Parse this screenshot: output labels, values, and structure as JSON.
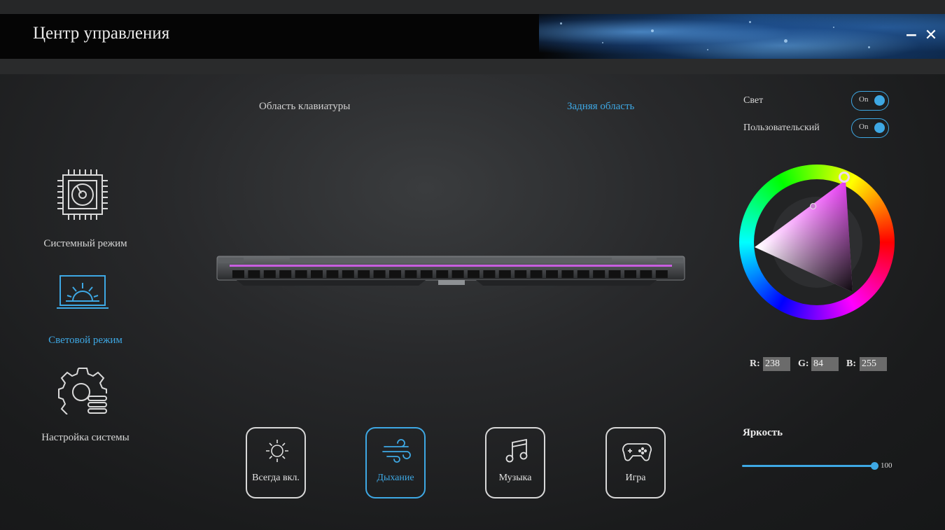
{
  "window": {
    "title": "Центр управления",
    "minimize_icon": "minus-icon",
    "close_icon": "close-x-icon",
    "minimize_glyph": "−",
    "close_glyph": "✕"
  },
  "sidebar": {
    "items": [
      {
        "label": "Системный режим",
        "icon": "cpu-chip-icon",
        "active": false
      },
      {
        "label": "Световой режим",
        "icon": "laptop-sunrise-icon",
        "active": true
      },
      {
        "label": "Настройка системы",
        "icon": "gear-settings-icon",
        "active": false
      }
    ]
  },
  "areas": {
    "keyboard": "Область клавиатуры",
    "rear": "Задняя область",
    "selected": "rear"
  },
  "lighting": {
    "light_label": "Свет",
    "light_toggle": "On",
    "custom_label": "Пользовательский",
    "custom_toggle": "On"
  },
  "color": {
    "r_label": "R:",
    "r": "238",
    "g_label": "G:",
    "g": "84",
    "b_label": "B:",
    "b": "255",
    "hex": "#ee54ff"
  },
  "brightness": {
    "label": "Яркость",
    "value": "100",
    "level": 1.0
  },
  "modes": [
    {
      "label": "Всегда вкл.",
      "icon": "sun-icon",
      "active": false
    },
    {
      "label": "Дыхание",
      "icon": "wind-icon",
      "active": true
    },
    {
      "label": "Музыка",
      "icon": "music-note-icon",
      "active": false
    },
    {
      "label": "Игра",
      "icon": "gamepad-icon",
      "active": false
    }
  ],
  "colors": {
    "accent": "#3ea8e4",
    "light_bar": "#c85ee0"
  }
}
